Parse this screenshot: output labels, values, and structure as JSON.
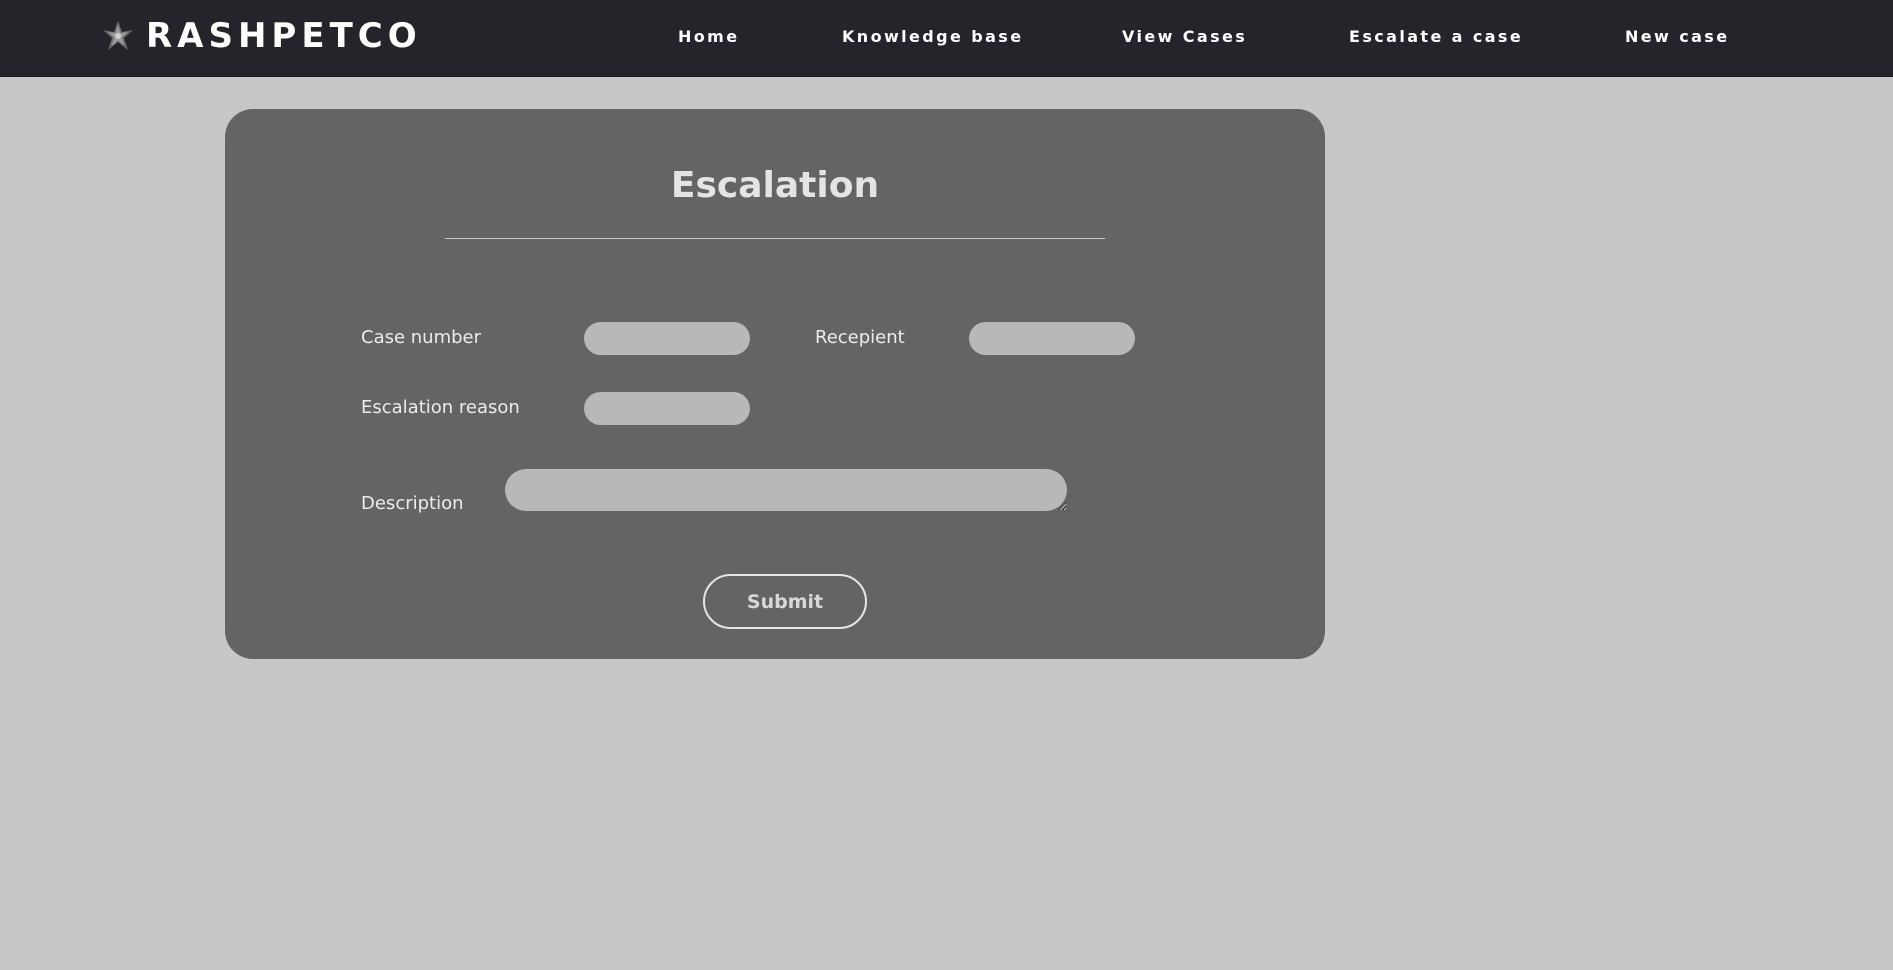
{
  "header": {
    "brand": "RASHPETCO",
    "logo_icon": "company-emblem-icon",
    "nav": {
      "home": "Home",
      "knowledge_base": "Knowledge base",
      "view_cases": "View Cases",
      "escalate": "Escalate a case",
      "new_case": "New case"
    }
  },
  "form": {
    "title": "Escalation",
    "case_number_label": "Case number",
    "case_number_value": "",
    "recipient_label": "Recepient",
    "recipient_value": "",
    "reason_label": "Escalation reason",
    "reason_value": "",
    "description_label": "Description",
    "description_value": "",
    "submit_label": "Submit"
  },
  "colors": {
    "page_background": "#c7c7c7",
    "navbar": "#24252a",
    "card": "#646464",
    "field": "#b8b8b8",
    "text_light": "#e4e4e4"
  }
}
